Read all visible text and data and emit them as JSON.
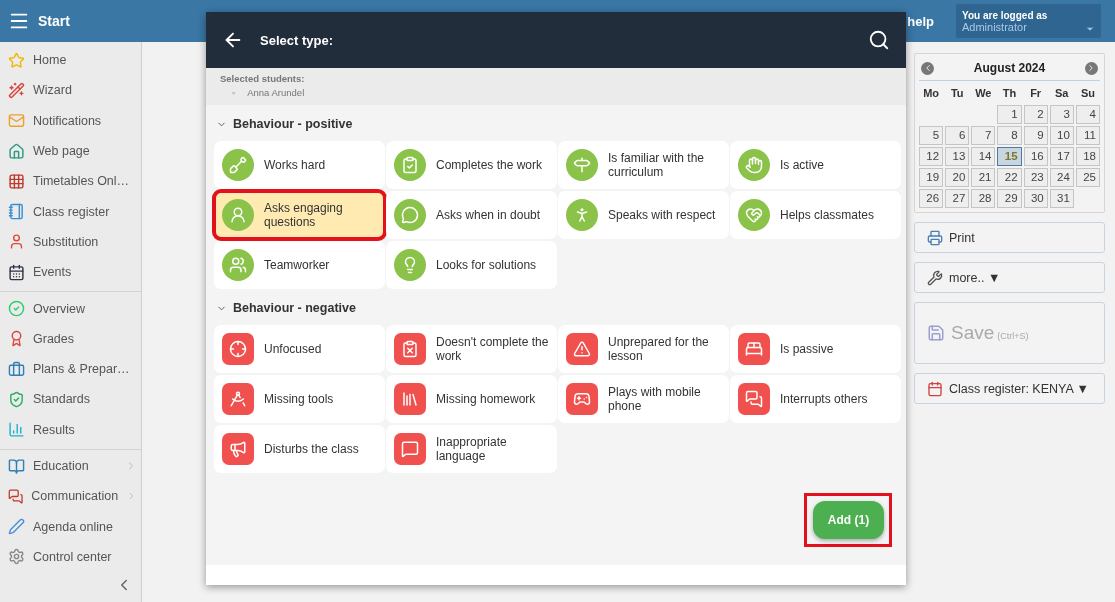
{
  "top_bar": {
    "title": "Start",
    "help": "help",
    "login": {
      "caption": "You are logged as",
      "user": "Administrator"
    }
  },
  "sidebar": {
    "groups": [
      {
        "items": [
          {
            "label": "Home",
            "submenu": false
          },
          {
            "label": "Wizard",
            "submenu": false
          },
          {
            "label": "Notifications",
            "submenu": false
          },
          {
            "label": "Web page",
            "submenu": false
          },
          {
            "label": "Timetables Onl…",
            "submenu": false
          },
          {
            "label": "Class register",
            "submenu": false
          },
          {
            "label": "Substitution",
            "submenu": false
          },
          {
            "label": "Events",
            "submenu": false
          }
        ]
      },
      {
        "items": [
          {
            "label": "Overview",
            "submenu": false
          },
          {
            "label": "Grades",
            "submenu": false
          },
          {
            "label": "Plans & Prepar…",
            "submenu": false
          },
          {
            "label": "Standards",
            "submenu": false
          },
          {
            "label": "Results",
            "submenu": false
          }
        ]
      },
      {
        "items": [
          {
            "label": "Education",
            "submenu": true
          },
          {
            "label": "Communication",
            "submenu": true
          },
          {
            "label": "Agenda online",
            "submenu": false
          },
          {
            "label": "Control center",
            "submenu": false
          }
        ]
      }
    ]
  },
  "dialog": {
    "title": "Select type:",
    "selected_students": {
      "label": "Selected students:",
      "students": [
        {
          "bullet": "◦",
          "name": "Anna Arundel"
        }
      ]
    },
    "sections": [
      {
        "title": "Behaviour - positive",
        "kind": "positive",
        "expanded": true,
        "items": [
          {
            "label": "Works hard",
            "selected": false
          },
          {
            "label": "Completes the work",
            "selected": false
          },
          {
            "label": "Is familiar with the curriculum",
            "selected": false
          },
          {
            "label": "Is active",
            "selected": false
          },
          {
            "label": "Asks engaging questions",
            "selected": true
          },
          {
            "label": "Asks when in doubt",
            "selected": false
          },
          {
            "label": "Speaks with respect",
            "selected": false
          },
          {
            "label": "Helps classmates",
            "selected": false
          },
          {
            "label": "Teamworker",
            "selected": false
          },
          {
            "label": "Looks for solutions",
            "selected": false
          }
        ]
      },
      {
        "title": "Behaviour - negative",
        "kind": "negative",
        "expanded": true,
        "items": [
          {
            "label": "Unfocused",
            "selected": false
          },
          {
            "label": "Doesn't complete the work",
            "selected": false
          },
          {
            "label": "Unprepared for the lesson",
            "selected": false
          },
          {
            "label": "Is passive",
            "selected": false
          },
          {
            "label": "Missing tools",
            "selected": false
          },
          {
            "label": "Missing homework",
            "selected": false
          },
          {
            "label": "Plays with mobile phone",
            "selected": false
          },
          {
            "label": "Interrupts others",
            "selected": false
          },
          {
            "label": "Disturbs the class",
            "selected": false
          },
          {
            "label": "Inappropriate language",
            "selected": false
          }
        ]
      }
    ],
    "add_button": {
      "label": "Add (1)",
      "highlighted": true
    }
  },
  "calendar": {
    "month": "August 2024",
    "weekdays": [
      "Mo",
      "Tu",
      "We",
      "Th",
      "Fr",
      "Sa",
      "Su"
    ],
    "days": [
      {
        "day": "1",
        "selected": false
      },
      {
        "day": "2",
        "selected": false
      },
      {
        "day": "3",
        "selected": false
      },
      {
        "day": "4",
        "selected": false
      },
      {
        "day": "5",
        "selected": false
      },
      {
        "day": "6",
        "selected": false
      },
      {
        "day": "7",
        "selected": false
      },
      {
        "day": "8",
        "selected": false
      },
      {
        "day": "9",
        "selected": false
      },
      {
        "day": "10",
        "selected": false
      },
      {
        "day": "11",
        "selected": false
      },
      {
        "day": "12",
        "selected": false
      },
      {
        "day": "13",
        "selected": false
      },
      {
        "day": "14",
        "selected": false
      },
      {
        "day": "15",
        "selected": true
      },
      {
        "day": "16",
        "selected": false
      },
      {
        "day": "17",
        "selected": false
      },
      {
        "day": "18",
        "selected": false
      },
      {
        "day": "19",
        "selected": false
      },
      {
        "day": "20",
        "selected": false
      },
      {
        "day": "21",
        "selected": false
      },
      {
        "day": "22",
        "selected": false
      },
      {
        "day": "23",
        "selected": false
      },
      {
        "day": "24",
        "selected": false
      },
      {
        "day": "25",
        "selected": false
      },
      {
        "day": "26",
        "selected": false
      },
      {
        "day": "27",
        "selected": false
      },
      {
        "day": "28",
        "selected": false
      },
      {
        "day": "29",
        "selected": false
      },
      {
        "day": "30",
        "selected": false
      },
      {
        "day": "31",
        "selected": false
      }
    ]
  },
  "actions": [
    {
      "kind": "print",
      "label": "Print"
    },
    {
      "kind": "more",
      "label": "more.. ▼"
    },
    {
      "kind": "save",
      "label": "Save",
      "hint": "(Ctrl+S)",
      "disabled": true
    },
    {
      "kind": "register",
      "label": "Class register: KENYA ▼"
    }
  ]
}
